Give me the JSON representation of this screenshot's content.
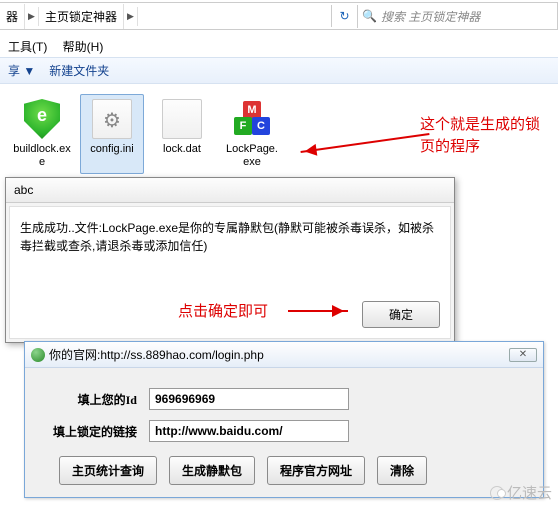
{
  "address": {
    "seg1": "器",
    "seg2": "主页锁定神器",
    "search_placeholder": "搜索 主页锁定神器"
  },
  "menu": {
    "tools": "工具(T)",
    "help": "帮助(H)"
  },
  "toolbar": {
    "share": "享 ▼",
    "newfolder": "新建文件夹"
  },
  "files": [
    {
      "name": "buildlock.exe"
    },
    {
      "name": "config.ini"
    },
    {
      "name": "lock.dat"
    },
    {
      "name": "LockPage.exe"
    }
  ],
  "annotations": {
    "a1_line1": "这个就是生成的锁",
    "a1_line2": "页的程序",
    "a2": "点击确定即可"
  },
  "dialog1": {
    "title": "abc",
    "message": "生成成功..文件:LockPage.exe是你的专属静默包(静默可能被杀毒误杀，如被杀毒拦截或查杀,请退杀毒或添加信任)",
    "ok": "确定"
  },
  "dialog2": {
    "title": "你的官网:http://ss.889hao.com/login.php",
    "close": "✕",
    "id_label": "填上您的Id",
    "id_value": "969696969",
    "link_label": "填上锁定的链接",
    "link_value": "http://www.baidu.com/",
    "btn_stats": "主页统计查询",
    "btn_gen": "生成静默包",
    "btn_site": "程序官方网址",
    "btn_clear": "清除"
  },
  "watermark": "亿速云"
}
